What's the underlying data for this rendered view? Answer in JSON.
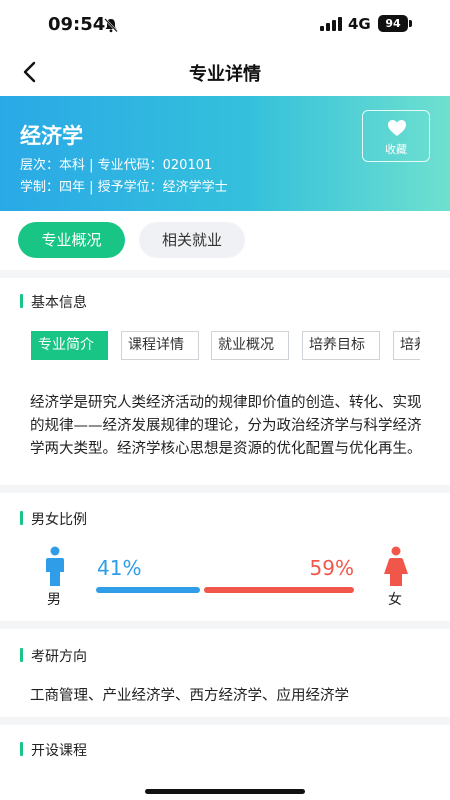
{
  "status": {
    "time": "09:54",
    "network": "4G",
    "battery": "94"
  },
  "nav": {
    "title": "专业详情"
  },
  "hero": {
    "name": "经济学",
    "line1": "层次：本科 | 专业代码：020101",
    "line2": "学制：四年 | 授予学位：经济学学士",
    "favorite_label": "收藏"
  },
  "tabs": [
    "专业概况",
    "相关就业"
  ],
  "basic_info": {
    "title": "基本信息",
    "chips": [
      "专业简介",
      "课程详情",
      "就业概况",
      "培养目标",
      "培养"
    ],
    "selected_chip": "专业简介",
    "intro": "经济学是研究人类经济活动的规律即价值的创造、转化、实现的规律——经济发展规律的理论，分为政治经济学与科学经济学两大类型。经济学核心思想是资源的优化配置与优化再生。"
  },
  "gender_ratio": {
    "title": "男女比例",
    "male_label": "男",
    "female_label": "女",
    "male_percent": "41%",
    "female_percent": "59%",
    "male_share": 0.41,
    "colors": {
      "male": "#2f9de8",
      "female": "#f0574a"
    }
  },
  "postgrad": {
    "title": "考研方向",
    "text": "工商管理、产业经济学、西方经济学、应用经济学"
  },
  "courses": {
    "title": "开设课程"
  },
  "colors": {
    "accent": "#19c585"
  }
}
